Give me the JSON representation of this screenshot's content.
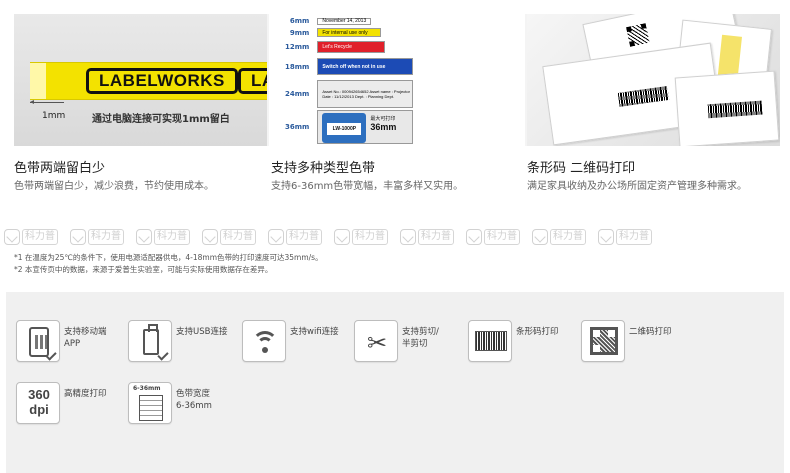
{
  "banner": {
    "panel1": {
      "tape_text": "LABELWORKS",
      "tape_text_cut": "LA",
      "margin_size": "1mm",
      "caption": "通过电脑连接可实现1mm留白"
    },
    "panel2": {
      "widths": [
        {
          "size": "6mm",
          "text": "November 14, 2013"
        },
        {
          "size": "9mm",
          "text": "For internal use only"
        },
        {
          "size": "12mm",
          "text": "Let's Recycle"
        },
        {
          "size": "18mm",
          "text": "Switch off when not in use"
        },
        {
          "size": "24mm",
          "text": "Asset No.: 000942654652  Asset name : Projector  Date : 11/12/2013  Dept. : Planning Dept."
        },
        {
          "size": "36mm",
          "text": "最大可打印",
          "big": "36mm",
          "device": "LW-1000P"
        }
      ]
    }
  },
  "captions": [
    {
      "title": "色带两端留白少",
      "sub": "色带两端留白少，减少浪费，节约使用成本。"
    },
    {
      "title": "支持多种类型色带",
      "sub": "支持6-36mm色带宽幅，丰富多样又实用。"
    },
    {
      "title": "条形码 二维码打印",
      "sub": "满足家具收纳及办公场所固定资产管理多种需求。"
    }
  ],
  "watermark": {
    "text": "科力普",
    "count": 10
  },
  "notes": [
    "*1 在温度为25℃的条件下，使用电源适配器供电，4-18mm色带的打印速度可达35mm/s。",
    "*2 本宣传页中的数据，来源于爱普生实验室，可能与实际使用数据存在差异。"
  ],
  "features": [
    {
      "icon": "phone-app-icon",
      "label": "支持移动端\nAPP"
    },
    {
      "icon": "usb-icon",
      "label": "支持USB连接"
    },
    {
      "icon": "wifi-icon",
      "label": "支持wifi连接"
    },
    {
      "icon": "scissors-icon",
      "label": "支持剪切/\n半剪切"
    },
    {
      "icon": "barcode-icon",
      "label": "条形码打印"
    },
    {
      "icon": "qrcode-icon",
      "label": "二维码打印"
    },
    {
      "icon": "dpi-icon",
      "label": "高精度打印",
      "icon_text_1": "360",
      "icon_text_2": "dpi"
    },
    {
      "icon": "tape-width-icon",
      "label": "色带宽度\n6-36mm",
      "icon_text": "6-36mm"
    }
  ]
}
